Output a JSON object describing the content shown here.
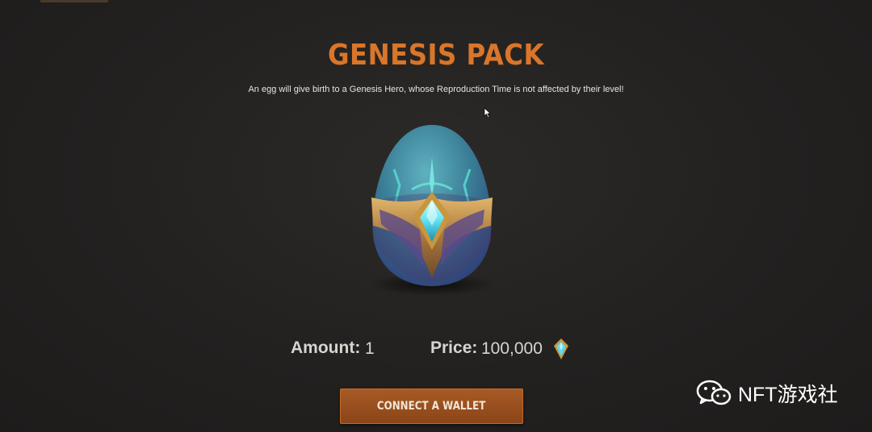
{
  "header": {
    "title": "GENESIS PACK",
    "subtitle": "An egg will give birth to a Genesis Hero, whose Reproduction Time is not affected by their level!"
  },
  "product": {
    "icon": "egg-icon"
  },
  "purchase": {
    "amount_label": "Amount:",
    "amount_value": "1",
    "price_label": "Price:",
    "price_value": "100,000",
    "currency_icon": "gem-icon",
    "connect_button": "CONNECT A WALLET"
  },
  "watermark": {
    "icon": "wechat-icon",
    "text": "NFT游戏社"
  },
  "colors": {
    "accent": "#d9762a",
    "button": "#9a4f1f",
    "background": "#252322"
  }
}
